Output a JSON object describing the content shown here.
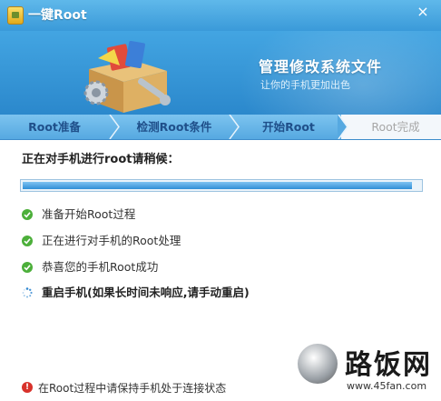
{
  "window": {
    "title": "一键Root",
    "close_glyph": "×"
  },
  "banner": {
    "title": "管理修改系统文件",
    "subtitle": "让你的手机更加出色",
    "art_icon": "toolbox-gear-wrench-icon"
  },
  "steps": [
    {
      "label": "Root准备",
      "state": "passed"
    },
    {
      "label": "检测Root条件",
      "state": "passed"
    },
    {
      "label": "开始Root",
      "state": "current"
    },
    {
      "label": "Root完成",
      "state": "pending"
    }
  ],
  "main": {
    "waiting_text": "正在对手机进行root请稍候：",
    "progress_fraction": 0.98,
    "status_items": [
      {
        "text": "准备开始Root过程",
        "icon": "check-circle-icon"
      },
      {
        "text": "正在进行对手机的Root处理",
        "icon": "check-circle-icon"
      },
      {
        "text": "恭喜您的手机Root成功",
        "icon": "check-circle-icon"
      },
      {
        "text": "重启手机(如果长时间未响应,请手动重启)",
        "icon": "loading-spinner-icon"
      }
    ]
  },
  "footer": {
    "note": "在Root过程中请保持手机处于连接状态",
    "icon": "warning-icon"
  },
  "watermark": {
    "text": "路饭网",
    "url": "www.45fan.com"
  },
  "colors": {
    "titlebar": "#3a9ad9",
    "banner": "#2b88cc",
    "steps_bar": "#56a9e1",
    "step_text": "#1f4f8a",
    "check_green": "#4caf3a",
    "warn_red": "#d8322b"
  }
}
